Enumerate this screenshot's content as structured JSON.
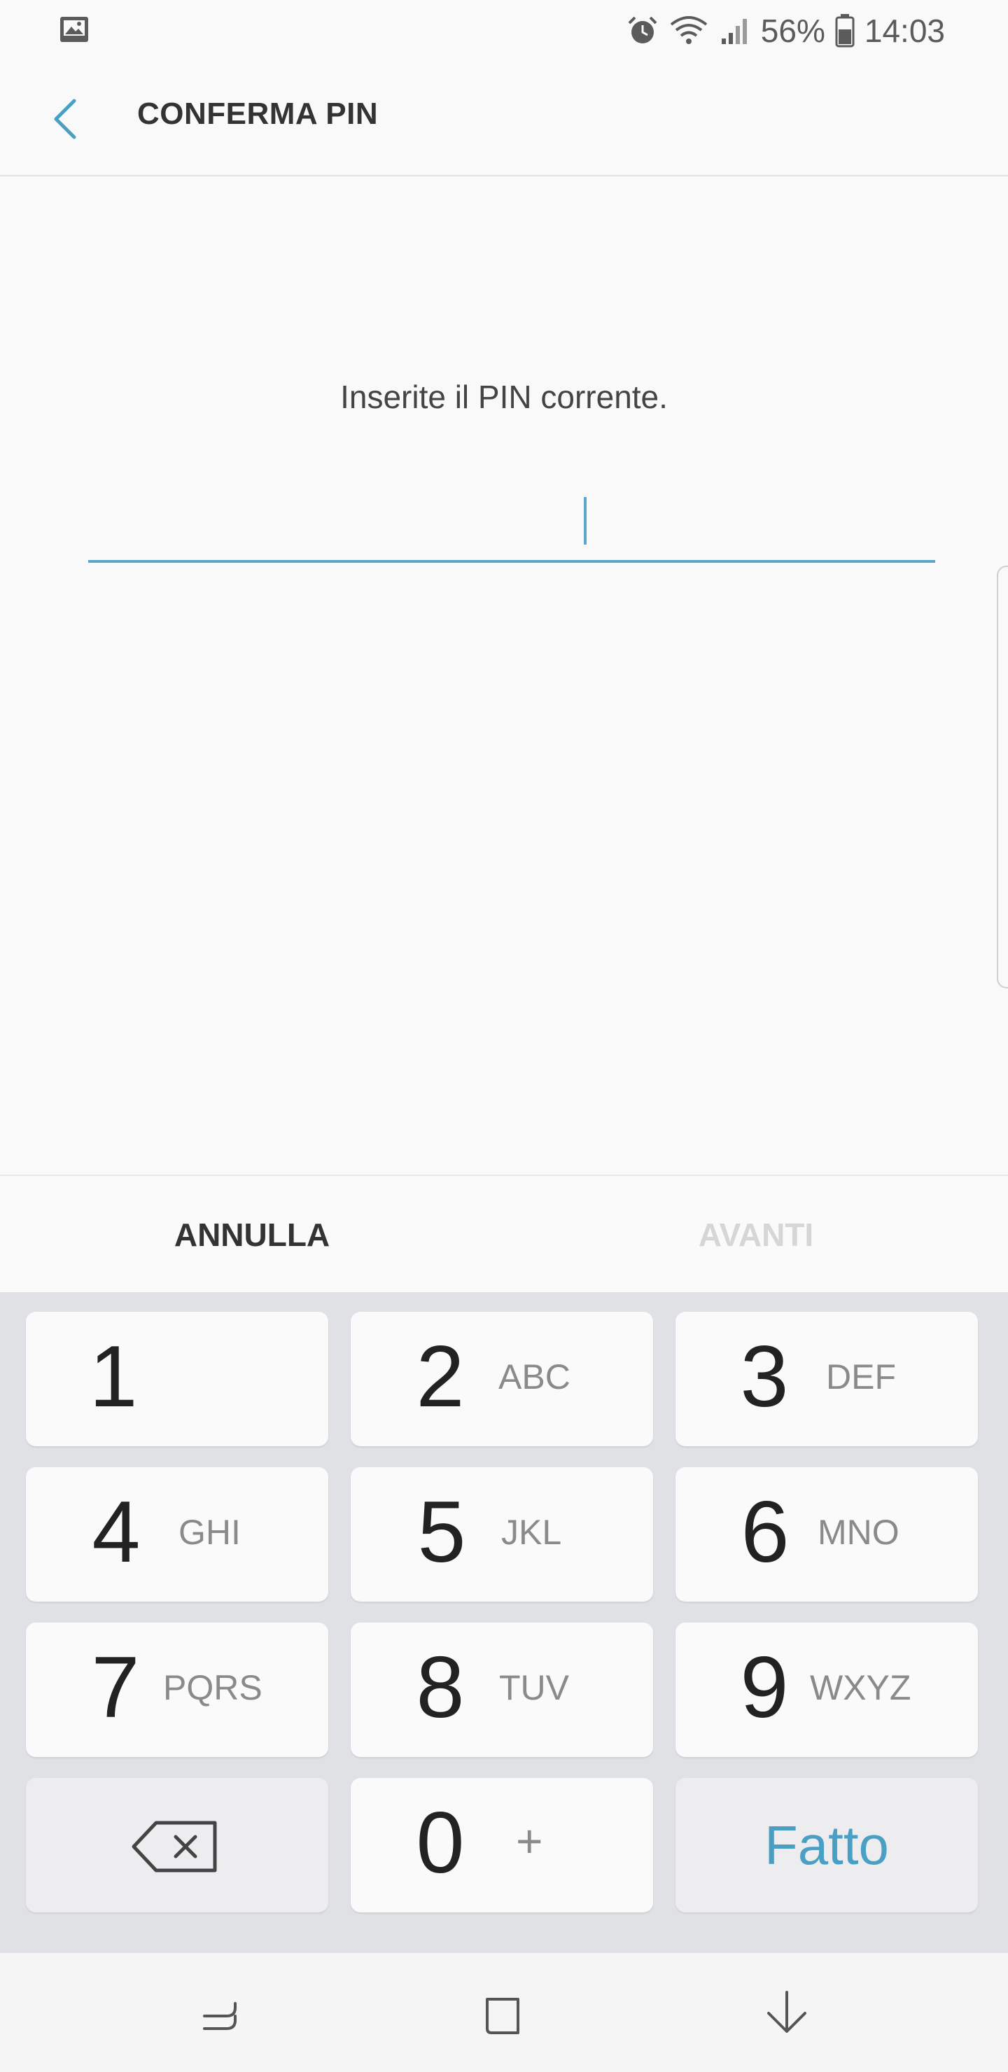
{
  "status_bar": {
    "battery_percent": "56%",
    "time": "14:03",
    "icons": [
      "gallery-icon",
      "alarm-icon",
      "wifi-icon",
      "signal-icon",
      "battery-icon"
    ]
  },
  "app_bar": {
    "title": "CONFERMA PIN",
    "back_icon": "chevron-left-icon"
  },
  "prompt": {
    "text": "Inserite il PIN corrente."
  },
  "pin_field": {
    "value": ""
  },
  "actions": {
    "cancel_label": "ANNULLA",
    "next_label": "AVANTI"
  },
  "keypad": {
    "keys": [
      {
        "digit": "1",
        "letters": ""
      },
      {
        "digit": "2",
        "letters": "ABC"
      },
      {
        "digit": "3",
        "letters": "DEF"
      },
      {
        "digit": "4",
        "letters": "GHI"
      },
      {
        "digit": "5",
        "letters": "JKL"
      },
      {
        "digit": "6",
        "letters": "MNO"
      },
      {
        "digit": "7",
        "letters": "PQRS"
      },
      {
        "digit": "8",
        "letters": "TUV"
      },
      {
        "digit": "9",
        "letters": "WXYZ"
      },
      {
        "digit": "0",
        "letters": "+"
      }
    ],
    "backspace_icon": "backspace-icon",
    "done_label": "Fatto"
  },
  "nav_bar": {
    "icons": [
      "recents-icon",
      "home-icon",
      "hide-keyboard-icon"
    ]
  },
  "colors": {
    "accent": "#4a9fc4",
    "keypad_background": "#dfe1e5"
  }
}
